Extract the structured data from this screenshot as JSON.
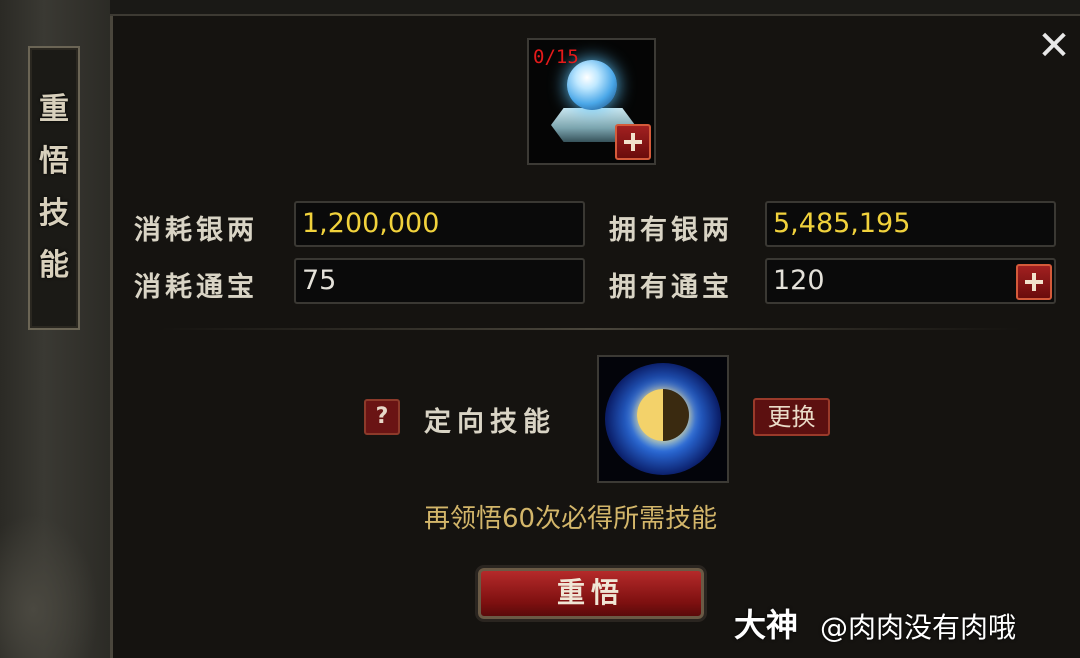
{
  "side": {
    "title_chars": [
      "重",
      "悟",
      "技",
      "能"
    ]
  },
  "close_icon": "close-icon",
  "item_slot": {
    "count": "0/15",
    "icon": "crystal-orb-icon"
  },
  "costs": {
    "silver_cost_label": "消耗银两",
    "silver_cost_value": "1,200,000",
    "silver_own_label": "拥有银两",
    "silver_own_value": "5,485,195",
    "treasure_cost_label": "消耗通宝",
    "treasure_cost_value": "75",
    "treasure_own_label": "拥有通宝",
    "treasure_own_value": "120"
  },
  "directed": {
    "help": "?",
    "label": "定向技能",
    "swap": "更换",
    "skill_icon": "yin-yang-vortex-icon",
    "hint": "再领悟60次必得所需技能"
  },
  "action": {
    "label": "重悟"
  },
  "watermark": {
    "brand": "大神",
    "user": "@肉肉没有肉哦"
  },
  "colors": {
    "gold": "#f1d23c",
    "red": "#e41a1a",
    "button": "#9a1a1a"
  }
}
